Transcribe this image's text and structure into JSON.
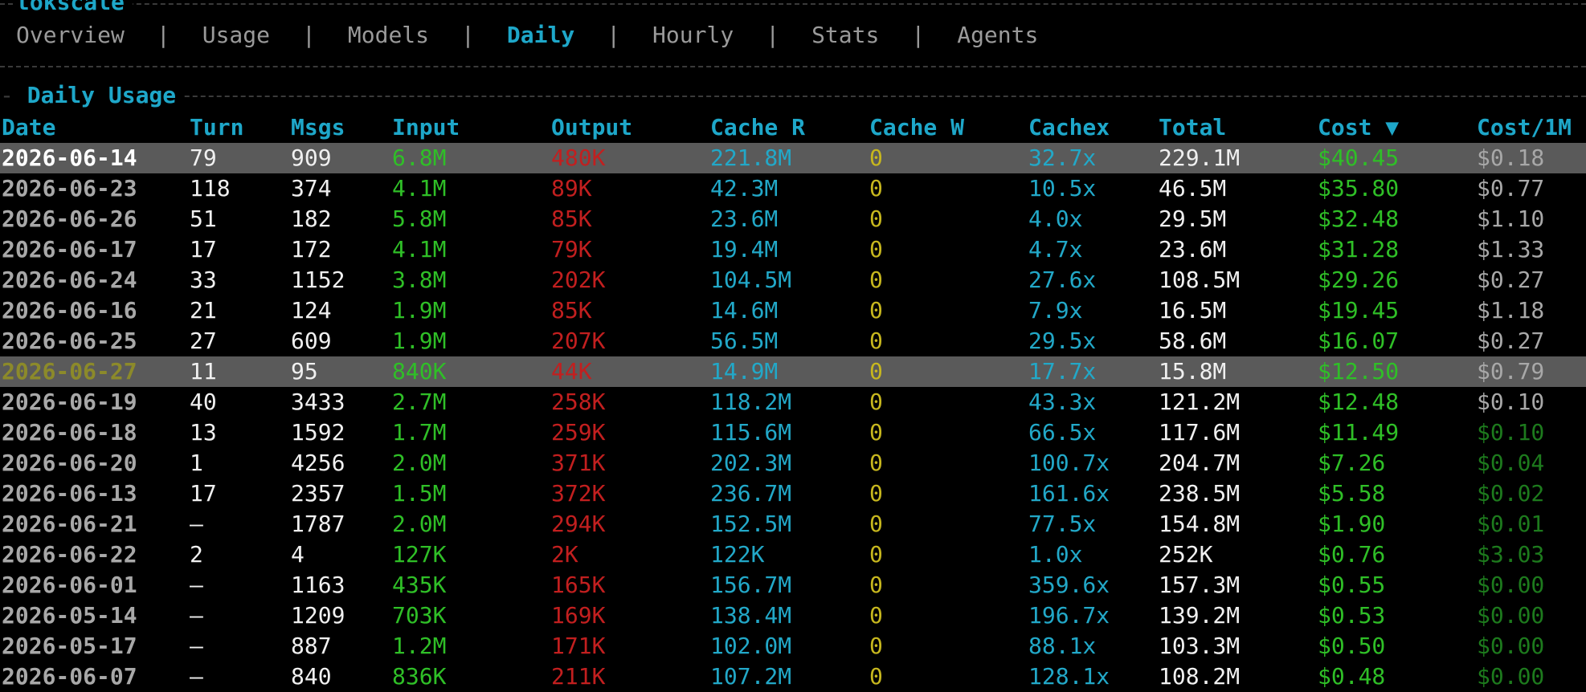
{
  "app_title": "tokscale",
  "tabs": [
    {
      "label": "Overview",
      "active": false
    },
    {
      "label": "Usage",
      "active": false
    },
    {
      "label": "Models",
      "active": false
    },
    {
      "label": "Daily",
      "active": true
    },
    {
      "label": "Hourly",
      "active": false
    },
    {
      "label": "Stats",
      "active": false
    },
    {
      "label": "Agents",
      "active": false
    }
  ],
  "tab_separator": "|",
  "section": {
    "title": "Daily Usage",
    "lead": "-"
  },
  "table": {
    "columns": [
      "Date",
      "Turn",
      "Msgs",
      "Input",
      "Output",
      "Cache R",
      "Cache W",
      "Cachex",
      "Total",
      "Cost ▼",
      "Cost/1M"
    ],
    "rows": [
      {
        "date": "2026-06-14",
        "turn": "79",
        "msgs": "909",
        "input": "6.8M",
        "output": "480K",
        "cache_r": "221.8M",
        "cache_w": "0",
        "cachex": "32.7x",
        "total": "229.1M",
        "cost": "$40.45",
        "cost_per_1m": "$0.18",
        "highlight": "selected"
      },
      {
        "date": "2026-06-23",
        "turn": "118",
        "msgs": "374",
        "input": "4.1M",
        "output": "89K",
        "cache_r": "42.3M",
        "cache_w": "0",
        "cachex": "10.5x",
        "total": "46.5M",
        "cost": "$35.80",
        "cost_per_1m": "$0.77"
      },
      {
        "date": "2026-06-26",
        "turn": "51",
        "msgs": "182",
        "input": "5.8M",
        "output": "85K",
        "cache_r": "23.6M",
        "cache_w": "0",
        "cachex": "4.0x",
        "total": "29.5M",
        "cost": "$32.48",
        "cost_per_1m": "$1.10"
      },
      {
        "date": "2026-06-17",
        "turn": "17",
        "msgs": "172",
        "input": "4.1M",
        "output": "79K",
        "cache_r": "19.4M",
        "cache_w": "0",
        "cachex": "4.7x",
        "total": "23.6M",
        "cost": "$31.28",
        "cost_per_1m": "$1.33"
      },
      {
        "date": "2026-06-24",
        "turn": "33",
        "msgs": "1152",
        "input": "3.8M",
        "output": "202K",
        "cache_r": "104.5M",
        "cache_w": "0",
        "cachex": "27.6x",
        "total": "108.5M",
        "cost": "$29.26",
        "cost_per_1m": "$0.27"
      },
      {
        "date": "2026-06-16",
        "turn": "21",
        "msgs": "124",
        "input": "1.9M",
        "output": "85K",
        "cache_r": "14.6M",
        "cache_w": "0",
        "cachex": "7.9x",
        "total": "16.5M",
        "cost": "$19.45",
        "cost_per_1m": "$1.18"
      },
      {
        "date": "2026-06-25",
        "turn": "27",
        "msgs": "609",
        "input": "1.9M",
        "output": "207K",
        "cache_r": "56.5M",
        "cache_w": "0",
        "cachex": "29.5x",
        "total": "58.6M",
        "cost": "$16.07",
        "cost_per_1m": "$0.27"
      },
      {
        "date": "2026-06-27",
        "turn": "11",
        "msgs": "95",
        "input": "840K",
        "output": "44K",
        "cache_r": "14.9M",
        "cache_w": "0",
        "cachex": "17.7x",
        "total": "15.8M",
        "cost": "$12.50",
        "cost_per_1m": "$0.79",
        "highlight": "hover"
      },
      {
        "date": "2026-06-19",
        "turn": "40",
        "msgs": "3433",
        "input": "2.7M",
        "output": "258K",
        "cache_r": "118.2M",
        "cache_w": "0",
        "cachex": "43.3x",
        "total": "121.2M",
        "cost": "$12.48",
        "cost_per_1m": "$0.10"
      },
      {
        "date": "2026-06-18",
        "turn": "13",
        "msgs": "1592",
        "input": "1.7M",
        "output": "259K",
        "cache_r": "115.6M",
        "cache_w": "0",
        "cachex": "66.5x",
        "total": "117.6M",
        "cost": "$11.49",
        "cost_per_1m": "$0.10",
        "dim_cpm": true
      },
      {
        "date": "2026-06-20",
        "turn": "1",
        "msgs": "4256",
        "input": "2.0M",
        "output": "371K",
        "cache_r": "202.3M",
        "cache_w": "0",
        "cachex": "100.7x",
        "total": "204.7M",
        "cost": "$7.26",
        "cost_per_1m": "$0.04",
        "dim_cpm": true
      },
      {
        "date": "2026-06-13",
        "turn": "17",
        "msgs": "2357",
        "input": "1.5M",
        "output": "372K",
        "cache_r": "236.7M",
        "cache_w": "0",
        "cachex": "161.6x",
        "total": "238.5M",
        "cost": "$5.58",
        "cost_per_1m": "$0.02",
        "dim_cpm": true
      },
      {
        "date": "2026-06-21",
        "turn": "–",
        "msgs": "1787",
        "input": "2.0M",
        "output": "294K",
        "cache_r": "152.5M",
        "cache_w": "0",
        "cachex": "77.5x",
        "total": "154.8M",
        "cost": "$1.90",
        "cost_per_1m": "$0.01",
        "dim_cpm": true
      },
      {
        "date": "2026-06-22",
        "turn": "2",
        "msgs": "4",
        "input": "127K",
        "output": "2K",
        "cache_r": "122K",
        "cache_w": "0",
        "cachex": "1.0x",
        "total": "252K",
        "cost": "$0.76",
        "cost_per_1m": "$3.03",
        "dim_cpm": true
      },
      {
        "date": "2026-06-01",
        "turn": "–",
        "msgs": "1163",
        "input": "435K",
        "output": "165K",
        "cache_r": "156.7M",
        "cache_w": "0",
        "cachex": "359.6x",
        "total": "157.3M",
        "cost": "$0.55",
        "cost_per_1m": "$0.00",
        "dim_cpm": true
      },
      {
        "date": "2026-05-14",
        "turn": "–",
        "msgs": "1209",
        "input": "703K",
        "output": "169K",
        "cache_r": "138.4M",
        "cache_w": "0",
        "cachex": "196.7x",
        "total": "139.2M",
        "cost": "$0.53",
        "cost_per_1m": "$0.00",
        "dim_cpm": true
      },
      {
        "date": "2026-05-17",
        "turn": "–",
        "msgs": "887",
        "input": "1.2M",
        "output": "171K",
        "cache_r": "102.0M",
        "cache_w": "0",
        "cachex": "88.1x",
        "total": "103.3M",
        "cost": "$0.50",
        "cost_per_1m": "$0.00",
        "dim_cpm": true
      },
      {
        "date": "2026-06-07",
        "turn": "–",
        "msgs": "840",
        "input": "836K",
        "output": "211K",
        "cache_r": "107.2M",
        "cache_w": "0",
        "cachex": "128.1x",
        "total": "108.2M",
        "cost": "$0.48",
        "cost_per_1m": "$0.00",
        "dim_cpm": true
      }
    ]
  },
  "colors": {
    "accent": "#1ea7c9",
    "input": "#2fbf27",
    "output": "#c21f1f",
    "cache": "#22a8c8",
    "cache_w": "#c7b71e",
    "highlight_bg": "#5a5a5a"
  }
}
